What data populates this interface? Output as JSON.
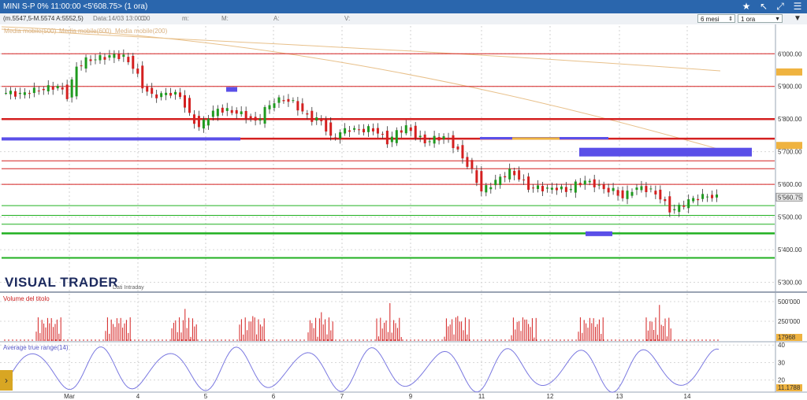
{
  "window": {
    "title": "MINI S-P 0% 11:00:00  <5'608.75> (1 ora)"
  },
  "toolbar": {
    "info": "(m.5547,5-M.5574 A:5552,5)",
    "date_field": "Data:14/03 13:00:00",
    "fields": [
      "C:",
      "m:",
      "M:",
      "A:",
      "V:"
    ],
    "period_range": "6 mesi",
    "period_interval": "1 ora"
  },
  "legend": {
    "ma500": "Media mobile(500)",
    "ma600": "Media mobile(600)",
    "ma200": "Media mobile(200)"
  },
  "branding": {
    "logo": "VISUAL TRADER",
    "subtitle": "Dati Intraday"
  },
  "panels": {
    "volume_label": "Volume del titolo",
    "atr_label": "Average true range(14)",
    "volume_value": "17968",
    "atr_value": "11.1788",
    "price_value": "5'560.75"
  },
  "colors": {
    "up": "#1f9a1f",
    "down": "#d42020",
    "resistance": "#d42020",
    "support": "#20b020",
    "zone_blue": "#5a4fe8",
    "zone_orange": "#efb340",
    "ma": "#e8c08a",
    "atr": "#7a78e0"
  },
  "chart_data": [
    {
      "type": "candlestick",
      "price_axis_ticks": [
        "6'000.00",
        "5'900.00",
        "5'800.00",
        "5'700.00",
        "5'600.00",
        "5'500.00",
        "5'400.00",
        "5'300.00"
      ],
      "price_axis_values": [
        6000,
        5900,
        5800,
        5700,
        5600,
        5500,
        5400,
        5300
      ],
      "x_ticks": [
        "Mar",
        "4",
        "5",
        "6",
        "7",
        "9",
        "11",
        "12",
        "13",
        "14"
      ],
      "ylim": [
        5270,
        6085
      ],
      "close_path": [
        5880,
        5875,
        5885,
        5890,
        5895,
        5900,
        5870,
        5960,
        5980,
        5985,
        5990,
        5995,
        5990,
        5960,
        5900,
        5870,
        5875,
        5880,
        5870,
        5810,
        5775,
        5810,
        5830,
        5825,
        5820,
        5810,
        5790,
        5830,
        5855,
        5860,
        5850,
        5820,
        5800,
        5795,
        5740,
        5760,
        5770,
        5765,
        5770,
        5760,
        5730,
        5760,
        5775,
        5750,
        5730,
        5740,
        5745,
        5720,
        5680,
        5640,
        5580,
        5600,
        5620,
        5640,
        5620,
        5590,
        5590,
        5585,
        5590,
        5580,
        5600,
        5610,
        5600,
        5585,
        5580,
        5560,
        5585,
        5590,
        5580,
        5560,
        5520,
        5530,
        5550,
        5560,
        5565,
        5560
      ],
      "horizontal_levels": [
        {
          "price": 6000,
          "color": "resistance",
          "width": 1
        },
        {
          "price": 5900,
          "color": "resistance",
          "width": 1
        },
        {
          "price": 5800,
          "color": "resistance",
          "width": 2.5
        },
        {
          "price": 5740,
          "color": "resistance",
          "width": 2.5
        },
        {
          "price": 5672,
          "color": "resistance",
          "width": 1
        },
        {
          "price": 5648,
          "color": "resistance",
          "width": 1
        },
        {
          "price": 5600,
          "color": "resistance",
          "width": 1
        },
        {
          "price": 5535,
          "color": "support",
          "width": 1
        },
        {
          "price": 5505,
          "color": "support",
          "width": 1
        },
        {
          "price": 5478,
          "color": "support",
          "width": 1
        },
        {
          "price": 5450,
          "color": "support",
          "width": 2.5
        },
        {
          "price": 5375,
          "color": "support",
          "width": 2
        }
      ]
    },
    {
      "type": "bar",
      "title": "Volume del titolo",
      "axis_ticks": [
        "500'000",
        "250'000"
      ],
      "axis_values": [
        500000,
        250000
      ]
    },
    {
      "type": "line",
      "title": "Average true range(14)",
      "axis_ticks": [
        "40",
        "30",
        "20"
      ],
      "axis_values": [
        40,
        30,
        20
      ],
      "ylim": [
        14,
        41
      ]
    }
  ]
}
